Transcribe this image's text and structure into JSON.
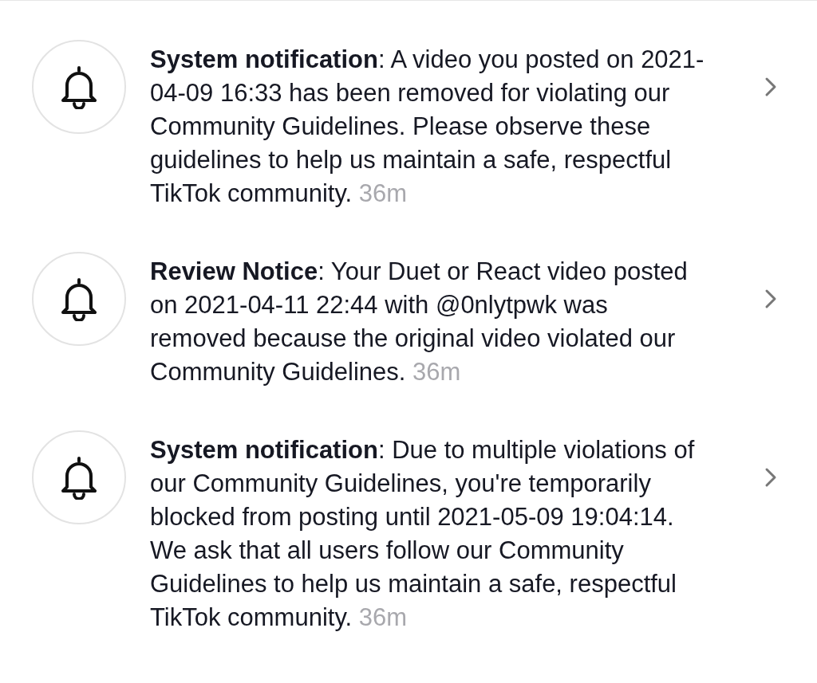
{
  "notifications": [
    {
      "message": "**System notification**: A video you posted on 2021-04-09 16:33 has been removed for violating our Community Guidelines. Please observe these guidelines to help us maintain a safe, respectful TikTok community.",
      "time": "36m"
    },
    {
      "message": "**Review Notice**: Your Duet or React video posted on 2021-04-11 22:44 with @0nlytpwk was removed because the original video violated our Community Guidelines.",
      "time": "36m"
    },
    {
      "message": "**System notification**: Due to multiple violations of our Community Guidelines, you're temporarily blocked from posting until 2021-05-09 19:04:14.\nWe ask that all users follow our Community Guidelines to help us maintain a safe, respectful TikTok community.",
      "time": "36m"
    }
  ]
}
